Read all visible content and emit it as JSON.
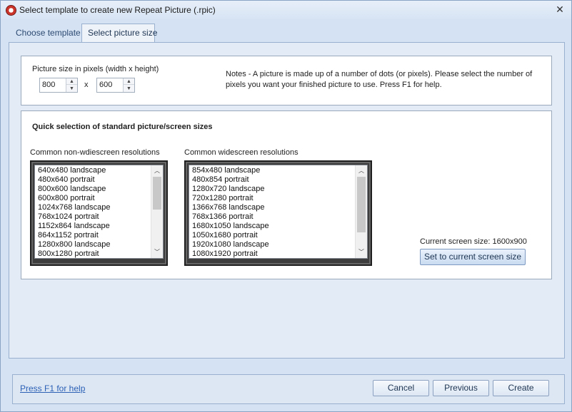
{
  "window": {
    "title": "Select template to create new Repeat Picture (.rpic)",
    "close_glyph": "✕",
    "icon": "app-logo-icon"
  },
  "tabs": [
    {
      "label": "Choose template",
      "active": false
    },
    {
      "label": "Select picture size",
      "active": true
    }
  ],
  "picture_size": {
    "label": "Picture size in pixels (width x height)",
    "width": "800",
    "height": "600",
    "separator": "x",
    "notes": "Notes - A picture is made up of a number of dots (or pixels).  Please select the number of pixels you want your finished picture to use.  Press F1 for help."
  },
  "quick_selection": {
    "heading": "Quick selection of standard picture/screen sizes",
    "non_widescreen": {
      "label": "Common non-wdiescreen resolutions",
      "items": [
        "640x480 landscape",
        "480x640 portrait",
        "800x600 landscape",
        "600x800 portrait",
        "1024x768 landscape",
        "768x1024 portrait",
        "1152x864 landscape",
        "864x1152 portrait",
        "1280x800 landscape",
        "800x1280 portrait"
      ]
    },
    "widescreen": {
      "label": "Common widescreen resolutions",
      "items": [
        "854x480 landscape",
        "480x854 portrait",
        "1280x720 landscape",
        "720x1280 portrait",
        "1366x768 landscape",
        "768x1366 portrait",
        "1680x1050 landscape",
        "1050x1680 portrait",
        "1920x1080 landscape",
        "1080x1920 portrait"
      ]
    },
    "current_screen": "Current screen size: 1600x900",
    "set_button": "Set to current screen size"
  },
  "footer": {
    "help_link": "Press F1 for help",
    "cancel": "Cancel",
    "previous": "Previous",
    "create": "Create"
  },
  "colors": {
    "window_bg": "#d4e2f3",
    "link": "#2b60b5",
    "accent": "#1e3552"
  }
}
